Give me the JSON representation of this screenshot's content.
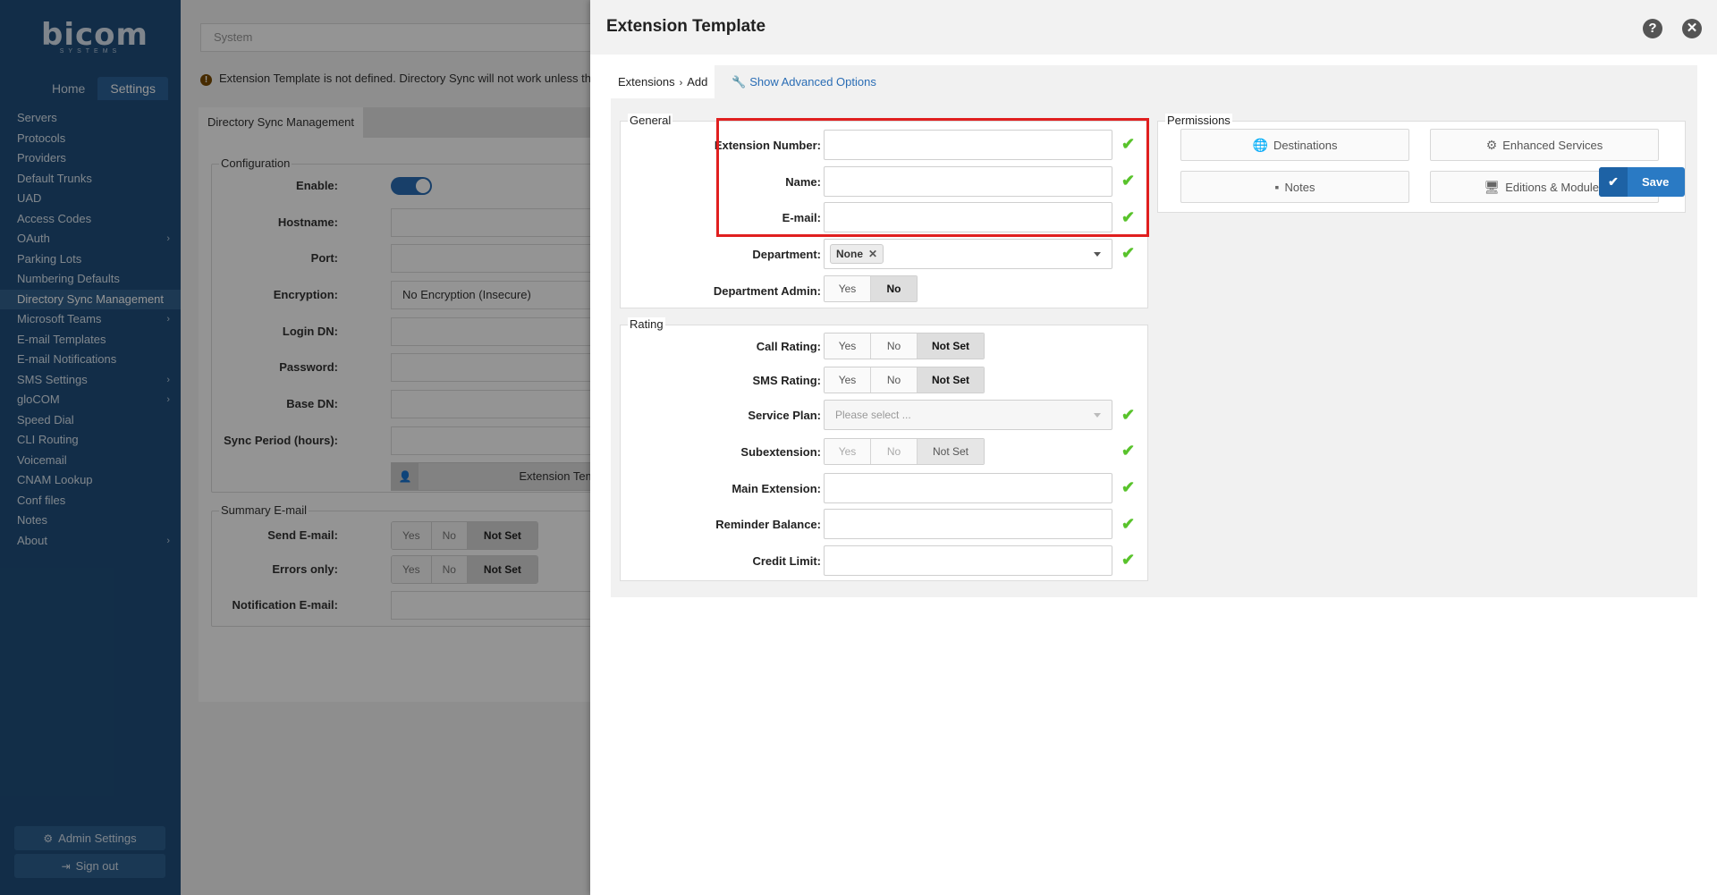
{
  "sidebar": {
    "logo": "bicom",
    "logo_sub": "SYSTEMS",
    "tabs": [
      "Home",
      "Settings"
    ],
    "items": [
      {
        "label": "Servers",
        "has_children": false
      },
      {
        "label": "Protocols",
        "has_children": false
      },
      {
        "label": "Providers",
        "has_children": false
      },
      {
        "label": "Default Trunks",
        "has_children": false
      },
      {
        "label": "UAD",
        "has_children": false
      },
      {
        "label": "Access Codes",
        "has_children": false
      },
      {
        "label": "OAuth",
        "has_children": true
      },
      {
        "label": "Parking Lots",
        "has_children": false
      },
      {
        "label": "Numbering Defaults",
        "has_children": false
      },
      {
        "label": "Directory Sync Management",
        "has_children": false,
        "active": true
      },
      {
        "label": "Microsoft Teams",
        "has_children": true
      },
      {
        "label": "E-mail Templates",
        "has_children": false
      },
      {
        "label": "E-mail Notifications",
        "has_children": false
      },
      {
        "label": "SMS Settings",
        "has_children": true
      },
      {
        "label": "gloCOM",
        "has_children": true
      },
      {
        "label": "Speed Dial",
        "has_children": false
      },
      {
        "label": "CLI Routing",
        "has_children": false
      },
      {
        "label": "Voicemail",
        "has_children": false
      },
      {
        "label": "CNAM Lookup",
        "has_children": false
      },
      {
        "label": "Conf files",
        "has_children": false
      },
      {
        "label": "Notes",
        "has_children": false
      },
      {
        "label": "About",
        "has_children": true
      }
    ],
    "admin_settings": "Admin Settings",
    "sign_out": "Sign out"
  },
  "background": {
    "search_placeholder": "System",
    "warning": "Extension Template is not defined. Directory Sync will not work unless the t",
    "tab": "Directory Sync Management",
    "configuration": {
      "legend": "Configuration",
      "enable_label": "Enable:",
      "enable_value": true,
      "hostname_label": "Hostname:",
      "port_label": "Port:",
      "encryption_label": "Encryption:",
      "encryption_value": "No Encryption (Insecure)",
      "login_dn_label": "Login DN:",
      "password_label": "Password:",
      "base_dn_label": "Base DN:",
      "sync_period_label": "Sync Period (hours):",
      "extension_template_button": "Extension Template"
    },
    "summary": {
      "legend": "Summary E-mail",
      "send_email_label": "Send E-mail:",
      "errors_only_label": "Errors only:",
      "notification_email_label": "Notification E-mail:",
      "options": [
        "Yes",
        "No",
        "Not Set"
      ],
      "selected": "Not Set"
    }
  },
  "modal": {
    "title": "Extension Template",
    "help_icon": "question-circle-icon",
    "close_icon": "close-circle-icon",
    "breadcrumb": [
      "Extensions",
      "Add"
    ],
    "advanced_link": "Show Advanced Options",
    "general": {
      "legend": "General",
      "extension_number_label": "Extension Number:",
      "extension_number_value": "",
      "name_label": "Name:",
      "name_value": "",
      "email_label": "E-mail:",
      "email_value": "",
      "department_label": "Department:",
      "department_value": "None",
      "department_admin_label": "Department Admin:",
      "department_admin_options": [
        "Yes",
        "No"
      ],
      "department_admin_selected": "No"
    },
    "rating": {
      "legend": "Rating",
      "call_rating_label": "Call Rating:",
      "sms_rating_label": "SMS Rating:",
      "rating_options": [
        "Yes",
        "No",
        "Not Set"
      ],
      "call_rating_selected": "Not Set",
      "sms_rating_selected": "Not Set",
      "service_plan_label": "Service Plan:",
      "service_plan_placeholder": "Please select ...",
      "subextension_label": "Subextension:",
      "subextension_selected": "Not Set",
      "main_extension_label": "Main Extension:",
      "reminder_balance_label": "Reminder Balance:",
      "credit_limit_label": "Credit Limit:"
    },
    "permissions": {
      "legend": "Permissions",
      "destinations": "Destinations",
      "enhanced_services": "Enhanced Services",
      "notes": "Notes",
      "editions_modules": "Editions & Modules"
    },
    "save": "Save"
  },
  "colors": {
    "sidebar_bg": "#1f4f7c",
    "accent": "#2a7ac4",
    "check": "#59c32c",
    "highlight": "#e01f1f"
  }
}
